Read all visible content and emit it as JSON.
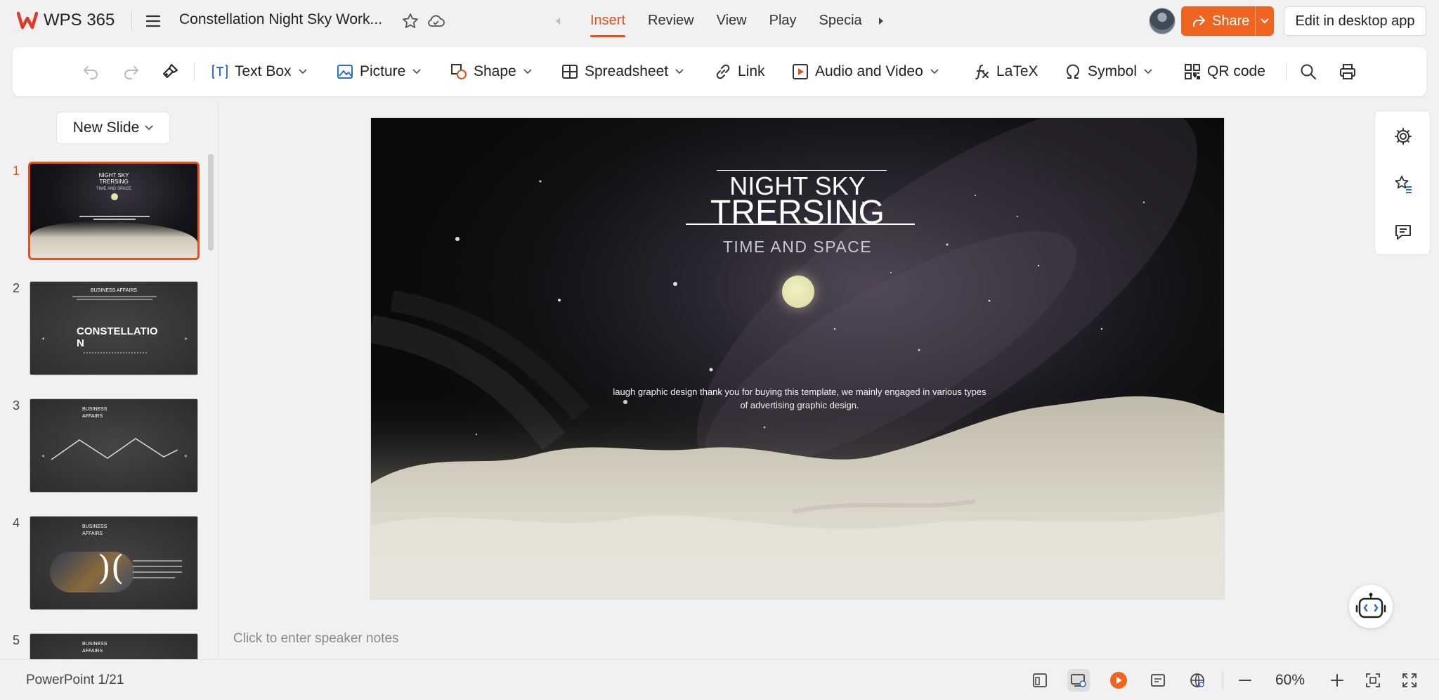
{
  "app": {
    "name": "WPS 365",
    "brand_color": "#e0531d"
  },
  "document": {
    "title": "Constellation Night Sky Work..."
  },
  "tabs": [
    {
      "label": "Insert",
      "active": true
    },
    {
      "label": "Review",
      "active": false
    },
    {
      "label": "View",
      "active": false
    },
    {
      "label": "Play",
      "active": false
    },
    {
      "label": "Specia",
      "active": false
    }
  ],
  "header": {
    "share_label": "Share",
    "desktop_label": "Edit in desktop app"
  },
  "ribbon": {
    "items": [
      {
        "label": "Text Box",
        "icon": "text-box-icon"
      },
      {
        "label": "Picture",
        "icon": "picture-icon"
      },
      {
        "label": "Shape",
        "icon": "shape-icon"
      },
      {
        "label": "Spreadsheet",
        "icon": "spreadsheet-icon"
      },
      {
        "label": "Link",
        "icon": "link-icon"
      },
      {
        "label": "Audio and Video",
        "icon": "audio-video-icon"
      },
      {
        "label": "LaTeX",
        "icon": "latex-icon"
      },
      {
        "label": "Symbol",
        "icon": "symbol-icon"
      },
      {
        "label": "QR code",
        "icon": "qr-code-icon"
      }
    ]
  },
  "sidebar": {
    "new_slide_label": "New Slide",
    "thumbnails": [
      {
        "number": "1",
        "active": true,
        "title_a": "NIGHT SKY",
        "title_b": "TRERSING",
        "subtitle": "TIME AND SPACE"
      },
      {
        "number": "2",
        "active": false,
        "title_a": "BUSINESS AFFAIRS",
        "title_b": "CONSTELLATIO",
        "title_c": "N"
      },
      {
        "number": "3",
        "active": false,
        "title_a": "BUSINESS",
        "title_b": "AFFAIRS"
      },
      {
        "number": "4",
        "active": false,
        "title_a": "BUSINESS",
        "title_b": "AFFAIRS"
      },
      {
        "number": "5",
        "active": false,
        "title_a": "BUSINESS",
        "title_b": "AFFAIRS"
      }
    ]
  },
  "slide": {
    "title_line1": "NIGHT SKY",
    "title_line2": "TRERSING",
    "subtitle": "TIME AND SPACE",
    "body_line1": "laugh graphic design thank you for buying this template, we mainly engaged in various types",
    "body_line2": "of advertising graphic design."
  },
  "notes": {
    "placeholder": "Click to enter speaker notes"
  },
  "status": {
    "slide_info": "PowerPoint 1/21",
    "zoom": "60%"
  }
}
